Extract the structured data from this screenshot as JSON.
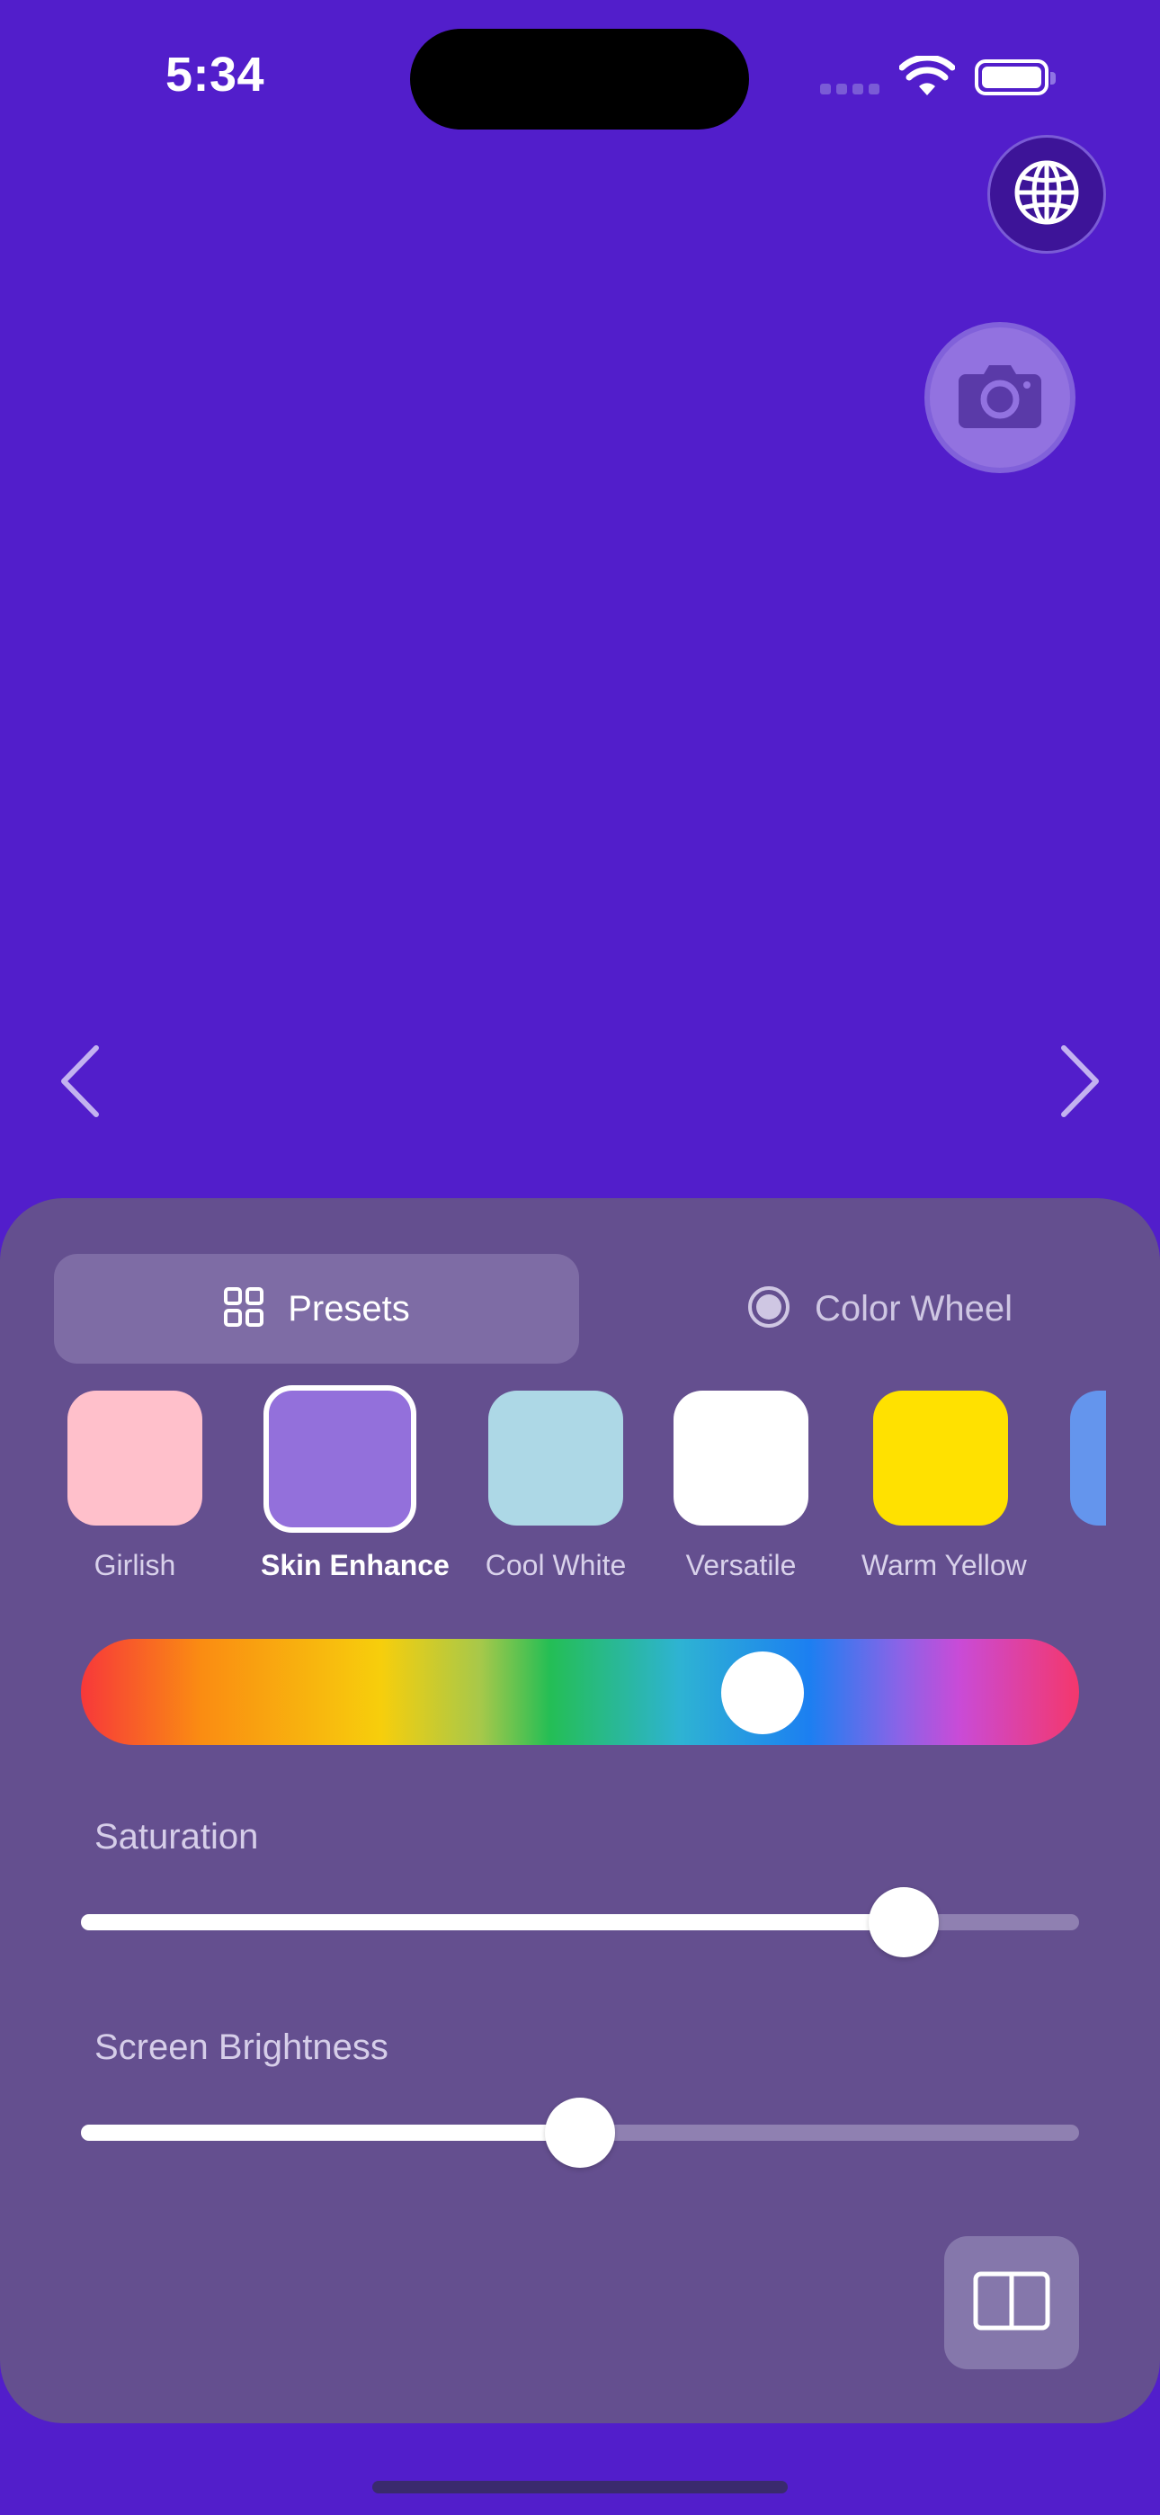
{
  "status_bar": {
    "time": "5:34"
  },
  "tabs": [
    {
      "label": "Presets",
      "selected": true
    },
    {
      "label": "Color Wheel",
      "selected": false
    }
  ],
  "presets": [
    {
      "label": "Girlish",
      "color": "#FFC0CB",
      "selected": false
    },
    {
      "label": "Skin Enhance",
      "color": "#9370DB",
      "selected": true
    },
    {
      "label": "Cool White",
      "color": "#ADD8E6",
      "selected": false
    },
    {
      "label": "Versatile",
      "color": "#FFFFFF",
      "selected": false
    },
    {
      "label": "Warm Yellow",
      "color": "#FFE100",
      "selected": false
    },
    {
      "label": "",
      "color": "#6495ED",
      "selected": false
    }
  ],
  "hue": {
    "value_fraction": 0.69
  },
  "saturation": {
    "label": "Saturation",
    "value_fraction": 0.825
  },
  "brightness": {
    "label": "Screen Brightness",
    "value_fraction": 0.5
  },
  "colors": {
    "background": "#521ECB",
    "panel": "#644F8F",
    "accent_thumb": "#FFFFFF"
  },
  "icons": {
    "globe": "globe-icon",
    "camera": "camera-icon",
    "prev": "chevron-left-icon",
    "next": "chevron-right-icon",
    "presets": "grid-icon",
    "color_wheel": "radio-icon",
    "split": "split-view-icon"
  }
}
